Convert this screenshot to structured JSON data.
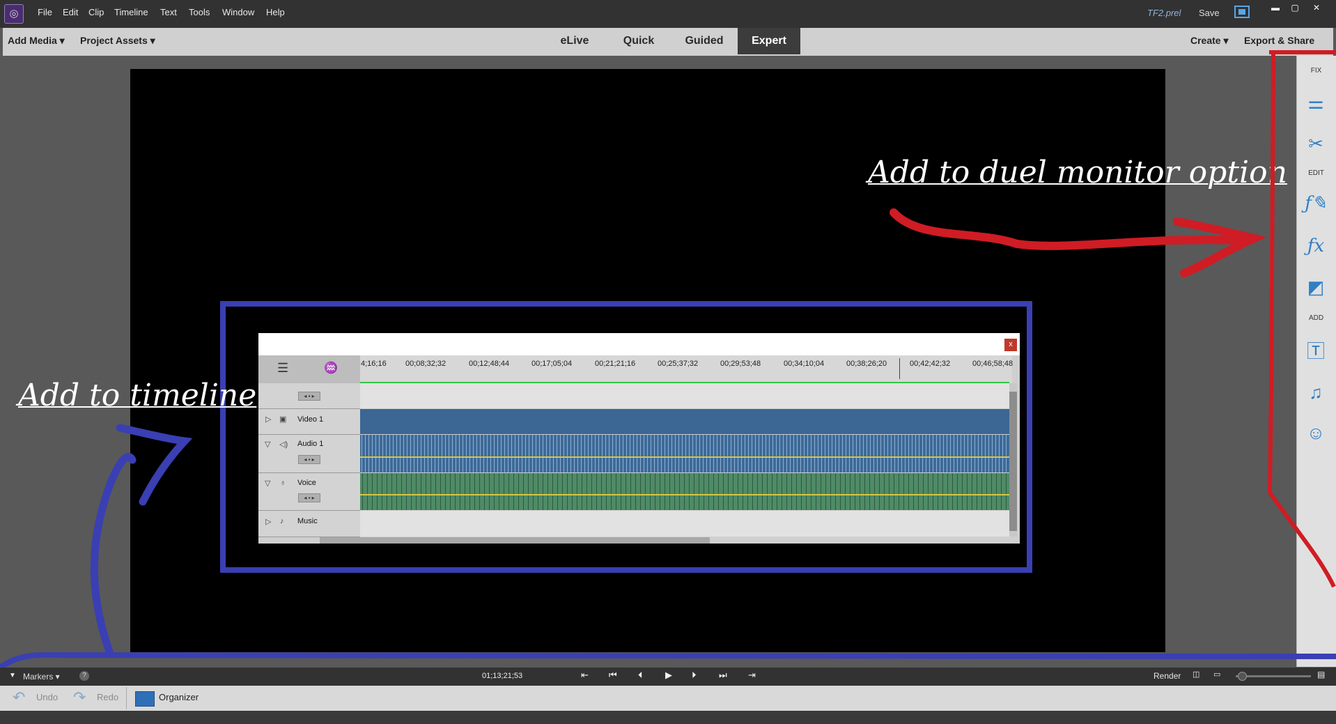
{
  "menu": [
    "File",
    "Edit",
    "Clip",
    "Timeline",
    "Text",
    "Tools",
    "Window",
    "Help"
  ],
  "title_bar": {
    "file_name": "TF2.prel",
    "save": "Save"
  },
  "mode_bar": {
    "add_media": "Add Media",
    "project_assets": "Project Assets",
    "tabs": [
      "eLive",
      "Quick",
      "Guided",
      "Expert"
    ],
    "active_tab": "Expert",
    "create": "Create",
    "export_share": "Export & Share"
  },
  "right_panel": {
    "fix": "FIX",
    "edit": "EDIT",
    "add": "ADD"
  },
  "annotations": {
    "dual_monitor": "Add to duel monitor option",
    "timeline": "Add to timeline"
  },
  "timeline_screenshot": {
    "ticks": [
      "4;16;16",
      "00;08;32;32",
      "00;12;48;44",
      "00;17;05;04",
      "00;21;21;16",
      "00;25;37;32",
      "00;29;53;48",
      "00;34;10;04",
      "00;38;26;20",
      "00;42;42;32",
      "00;46;58;48"
    ],
    "tracks": [
      "Video 1",
      "Audio 1",
      "Voice",
      "Music"
    ],
    "close": "x"
  },
  "controls": {
    "markers": "Markers",
    "timecode": "01;13;21;53",
    "render": "Render"
  },
  "action_bar": {
    "undo": "Undo",
    "redo": "Redo",
    "organizer": "Organizer"
  }
}
